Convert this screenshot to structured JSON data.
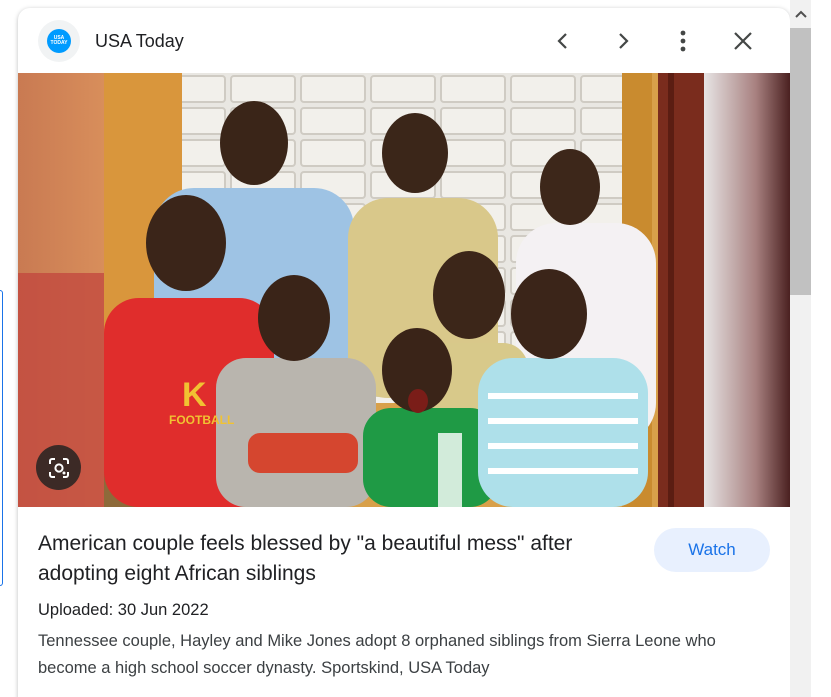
{
  "header": {
    "source_name": "USA Today",
    "favicon_text_line1": "USA",
    "favicon_text_line2": "TODAY",
    "icons": [
      "chevron-left-icon",
      "chevron-right-icon",
      "more-vert-icon",
      "close-icon"
    ]
  },
  "media": {
    "shirt_text_letter": "K",
    "shirt_text_word": "FOOTBALL",
    "lens_icon": "google-lens-icon"
  },
  "article": {
    "title": "American couple feels blessed by \"a beautiful mess\" after adopting eight African siblings",
    "watch_label": "Watch",
    "uploaded": "Uploaded: 30 Jun 2022",
    "description": "Tennessee couple, Hayley and Mike Jones adopt 8 orphaned siblings from Sierra Leone who become a high school soccer dynasty. Sportskind, USA Today"
  },
  "colors": {
    "accent": "#1a73e8",
    "watch_bg": "#e8f0fe",
    "favicon": "#009bff"
  }
}
